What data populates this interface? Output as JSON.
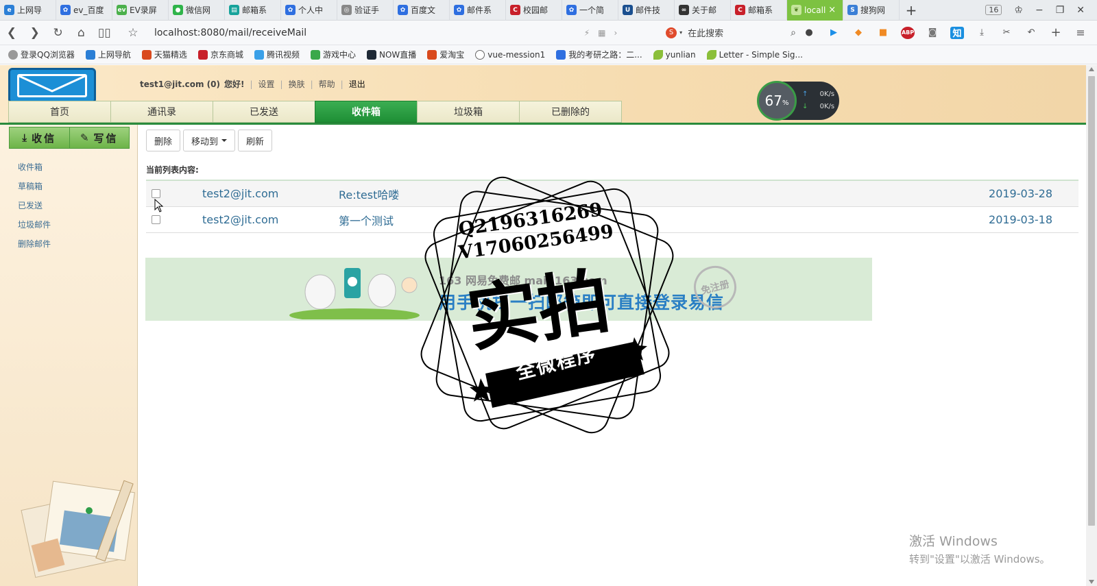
{
  "browser": {
    "tabs": [
      {
        "label": "上网导",
        "icon_color": "#2b7fd6",
        "icon": "ie-icon"
      },
      {
        "label": "ev_百度",
        "icon_color": "#2f6fe0",
        "icon": "baidu-paw-icon"
      },
      {
        "label": "EV录屏",
        "icon_color": "#4bb04b",
        "icon": "ev-icon"
      },
      {
        "label": "微信网",
        "icon_color": "#2fb44a",
        "icon": "wechat-icon"
      },
      {
        "label": "邮箱系",
        "icon_color": "#17a39b",
        "icon": "book-icon"
      },
      {
        "label": "个人中",
        "icon_color": "#2f6fe0",
        "icon": "baidu-paw-icon"
      },
      {
        "label": "验证手",
        "icon_color": "#888888",
        "icon": "globe-icon"
      },
      {
        "label": "百度文",
        "icon_color": "#2f6fe0",
        "icon": "baidu-paw-icon"
      },
      {
        "label": "邮件系",
        "icon_color": "#2f6fe0",
        "icon": "baidu-paw-icon"
      },
      {
        "label": "校园邮",
        "icon_color": "#c8202a",
        "icon": "csdn-icon"
      },
      {
        "label": "一个简",
        "icon_color": "#2f6fe0",
        "icon": "baidu-paw-icon"
      },
      {
        "label": "邮件技",
        "icon_color": "#1a4f8f",
        "icon": "u-icon"
      },
      {
        "label": "关于邮",
        "icon_color": "#333333",
        "icon": "link-icon"
      },
      {
        "label": "邮箱系",
        "icon_color": "#c8202a",
        "icon": "csdn-icon"
      },
      {
        "label": "locall",
        "icon_color": "#c5e59c",
        "icon": "leaf-icon",
        "active": true
      },
      {
        "label": "搜狗网",
        "icon_color": "#3b7fd6",
        "icon": "sogou-icon"
      }
    ],
    "tab_count": "16",
    "url": "localhost:8080/mail/receiveMail",
    "search_placeholder": "在此搜索",
    "bookmarks": [
      {
        "label": "登录QQ浏览器",
        "color": "#888888"
      },
      {
        "label": "上网导航",
        "color": "#2b7fd6"
      },
      {
        "label": "天猫精选",
        "color": "#d94a1e"
      },
      {
        "label": "京东商城",
        "color": "#c8202a"
      },
      {
        "label": "腾讯视频",
        "color": "#3aa0e8"
      },
      {
        "label": "游戏中心",
        "color": "#3aa84a"
      },
      {
        "label": "NOW直播",
        "color": "#1f2a36"
      },
      {
        "label": "爱淘宝",
        "color": "#d94a1e"
      },
      {
        "label": "vue-mession1",
        "color": "#666666"
      },
      {
        "label": "我的考研之路：二...",
        "color": "#2f6fe0"
      },
      {
        "label": "yunlian",
        "color": "#8bbf3a"
      },
      {
        "label": "Letter - Simple Sig...",
        "color": "#8bbf3a"
      }
    ]
  },
  "mail": {
    "user": "test1@jit.com (0)",
    "greeting": "您好!",
    "links": [
      "设置",
      "换肤",
      "帮助",
      "退出"
    ],
    "menu": [
      "首页",
      "通讯录",
      "已发送",
      "收件箱",
      "垃圾箱",
      "已删除的"
    ],
    "active_menu": 3,
    "speed": {
      "percent": "67",
      "unit": "%",
      "up": "0K/s",
      "down": "0K/s"
    },
    "side_buttons": [
      "收信",
      "写信"
    ],
    "side_links": [
      "收件箱",
      "草稿箱",
      "已发送",
      "垃圾邮件",
      "删除邮件"
    ],
    "toolbar": {
      "delete": "删除",
      "move": "移动到",
      "refresh": "刷新"
    },
    "list_title": "当前列表内容:",
    "messages": [
      {
        "from": "test2@jit.com",
        "subject": "Re:test哈喽",
        "date": "2019-03-28"
      },
      {
        "from": "test2@jit.com",
        "subject": "第一个测试",
        "date": "2019-03-18"
      }
    ],
    "banner": {
      "brand": "163 网易免费邮 mail.163.com",
      "text": "用手机扫一扫邮箱即可直接登录易信",
      "stamp": "免注册"
    }
  },
  "watermark": {
    "line1": "Q2196316269",
    "line2": "V17060256499",
    "big": "实拍",
    "sub": "全微程序"
  },
  "os": {
    "activate_title": "激活 Windows",
    "activate_sub": "转到\"设置\"以激活 Windows。"
  },
  "colors": {
    "accent_green": "#1e8e35",
    "link_blue": "#2f6c94"
  }
}
